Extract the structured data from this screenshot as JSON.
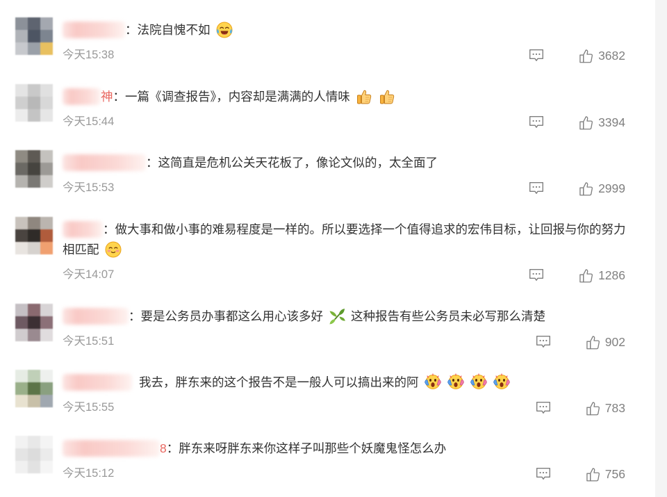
{
  "colors": {
    "background": "#ffffff",
    "text": "#333333",
    "meta": "#999999",
    "count": "#808080",
    "icon": "#7f7f7f",
    "username": "#e8655e"
  },
  "icons": {
    "comment": "comment-icon",
    "like": "like-icon"
  },
  "comments": [
    {
      "text": "：法院自愧不如",
      "emojis": [
        "laughing-crying-emoji"
      ],
      "time": "今天15:38",
      "likes": 3682,
      "avatar_mosaic": [
        "#8c9199",
        "#5e6470",
        "#a4a8b0",
        "#b0b3b8",
        "#4d5563",
        "#7d8590",
        "#c7c9cd",
        "#9aa0a8",
        "#e8c060"
      ]
    },
    {
      "username_visible": "神",
      "text": "：一篇《调查报告》，内容却是满满的人情味",
      "emojis": [
        "thumbs-up-emoji",
        "thumbs-up-emoji"
      ],
      "time": "今天15:44",
      "likes": 3394,
      "avatar_mosaic": [
        "#e4e4e4",
        "#c9c9c9",
        "#e0e0e0",
        "#cfcfcf",
        "#b8b8b8",
        "#d8d8d8",
        "#ececec",
        "#c4c4c4",
        "#e6e6e6"
      ]
    },
    {
      "text": "：这简直是危机公关天花板了，像论文似的，太全面了",
      "emojis": [],
      "time": "今天15:53",
      "likes": 2999,
      "avatar_mosaic": [
        "#8f8b83",
        "#5e5a54",
        "#c4c2be",
        "#6b6964",
        "#46443f",
        "#9c9a96",
        "#b5b3af",
        "#7a7874",
        "#cfcdca"
      ]
    },
    {
      "text": "：做大事和做小事的难易程度是一样的。所以要选择一个值得追求的宏伟目标，让回报与你的努力相匹配",
      "emojis": [
        "shy-face-emoji"
      ],
      "time": "今天14:07",
      "likes": 1286,
      "avatar_mosaic": [
        "#c8c2bc",
        "#8f877f",
        "#bbb5af",
        "#4a4440",
        "#2f2b28",
        "#b05c3c",
        "#e8e4e0",
        "#d6d2ce",
        "#f0a070"
      ]
    },
    {
      "text": "：要是公务员办事都这么用心该多好",
      "emojis": [
        "bamboo-emoji"
      ],
      "text_after": "这种报告有些公务员未必写那么清楚",
      "time": "今天15:51",
      "likes": 902,
      "avatar_mosaic": [
        "#c5c0c4",
        "#8a6a70",
        "#d8d4d6",
        "#6e5a62",
        "#3c3034",
        "#8c7078",
        "#d0ccce",
        "#9a8a90",
        "#e0dcde"
      ]
    },
    {
      "text": "我去，胖东来的这个报告不是一般人可以搞出来的阿",
      "emojis": [
        "scream-face-emoji",
        "scream-face-emoji",
        "scream-face-emoji",
        "scream-face-emoji"
      ],
      "time": "今天15:55",
      "likes": 783,
      "avatar_mosaic": [
        "#e6ece4",
        "#c0d0b8",
        "#eef0ee",
        "#9ab08a",
        "#5c7448",
        "#8aa080",
        "#e8e2d0",
        "#c8c0a8",
        "#a0a8b0"
      ]
    },
    {
      "username_visible": "8",
      "text": "：胖东来呀胖东来你这样子叫那些个妖魔鬼怪怎么办",
      "emojis": [],
      "time": "今天15:12",
      "likes": 756,
      "avatar_mosaic": [
        "#f2f2f2",
        "#e8e8e8",
        "#f4f4f4",
        "#e4e4e4",
        "#dcdcdc",
        "#ebebeb",
        "#f0f0f0",
        "#e2e2e2",
        "#f5f5f5"
      ]
    }
  ]
}
